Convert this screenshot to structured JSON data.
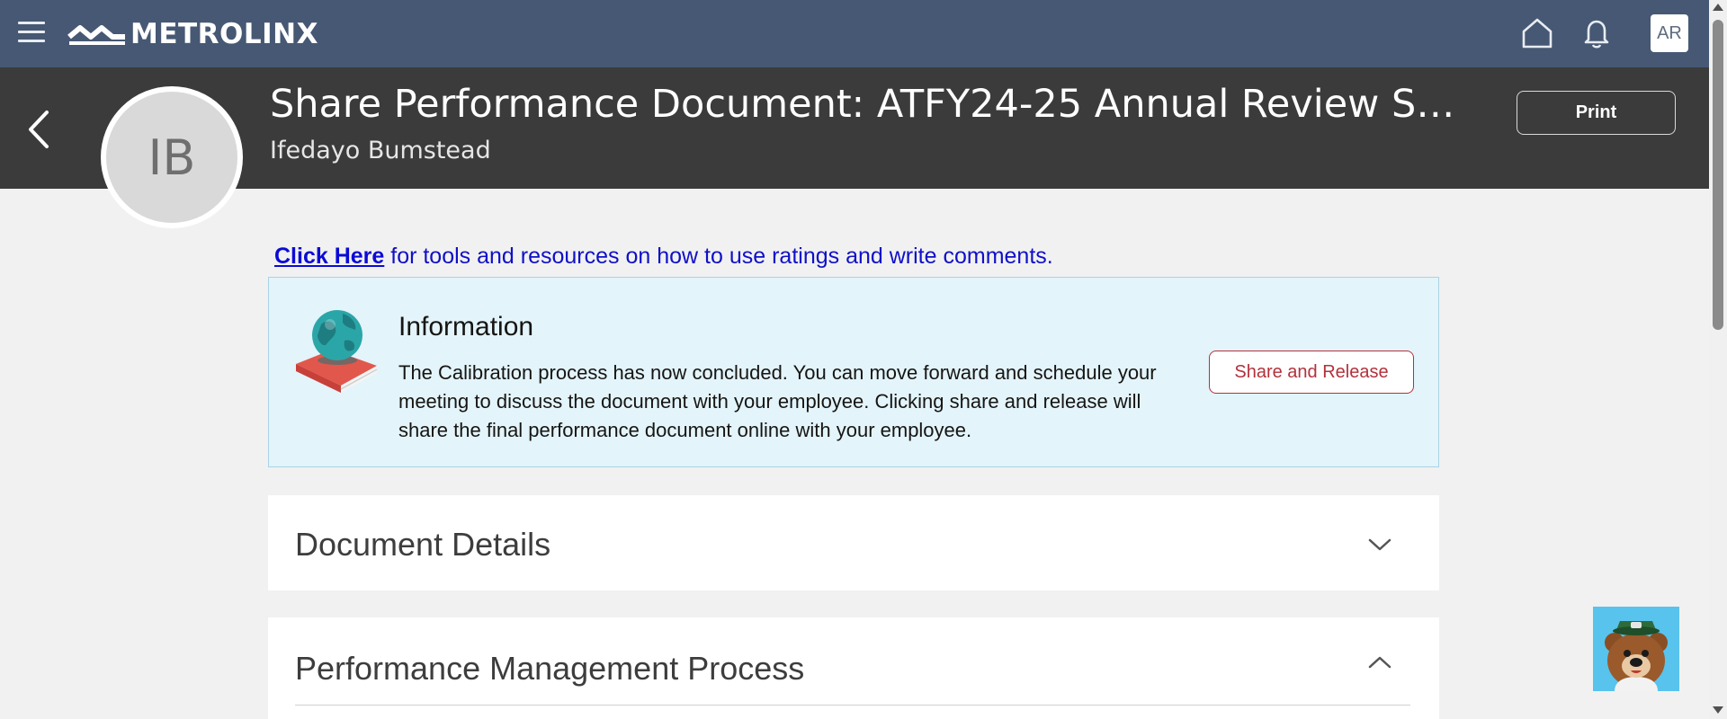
{
  "app": {
    "logo_text": "METROLINX",
    "user_initials": "AR"
  },
  "header": {
    "title": "Share Performance Document: ATFY24-25 Annual Review Senior Man...",
    "employee_name": "Ifedayo Bumstead",
    "employee_initials": "IB",
    "print_label": "Print"
  },
  "help": {
    "link_text": "Click Here",
    "rest_text": " for tools and resources on how to use ratings and write comments."
  },
  "info": {
    "title": "Information",
    "message": "The Calibration process has now concluded. You can move forward and schedule your meeting to discuss the document with your employee. Clicking share and release will share the final performance document online with your employee.",
    "button_label": "Share and Release"
  },
  "sections": [
    {
      "title": "Document Details",
      "state": "collapsed",
      "icon": "chevron-down-icon"
    },
    {
      "title": "Performance Management Process",
      "state": "expanded",
      "icon": "chevron-up-icon"
    }
  ],
  "colors": {
    "topbar": "#465873",
    "header": "#3b3b3b",
    "info_bg": "#e3f4fa",
    "accent_red": "#b3313b",
    "link": "#0b0bd6"
  }
}
